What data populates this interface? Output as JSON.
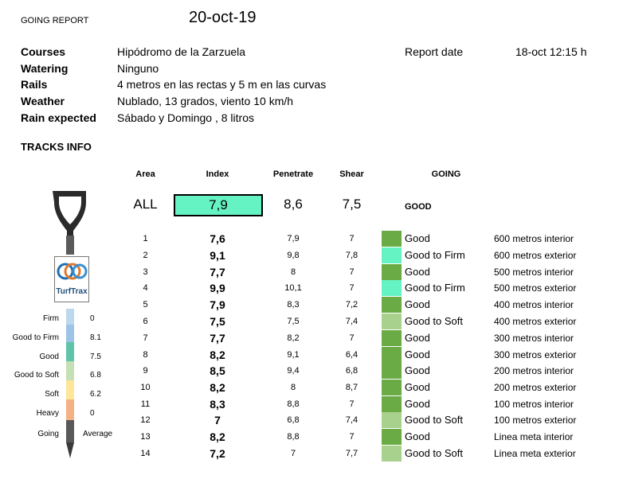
{
  "title": "GOING REPORT",
  "date": "20-oct-19",
  "info": {
    "courses": {
      "label": "Courses",
      "value": "Hipódromo de la Zarzuela"
    },
    "watering": {
      "label": "Watering",
      "value": "Ninguno"
    },
    "rails": {
      "label": "Rails",
      "value": "4 metros en las rectas y 5 m en las curvas"
    },
    "weather": {
      "label": "Weather",
      "value": "Nublado, 13 grados, viento 10 km/h"
    },
    "rain": {
      "label": "Rain expected",
      "value": "Sábado y Domingo , 8 litros"
    }
  },
  "report_date": {
    "label": "Report date",
    "value": "18-oct  12:15 h"
  },
  "tracks_info_label": "TRACKS INFO",
  "headers": {
    "area": "Area",
    "index": "Index",
    "penetrate": "Penetrate",
    "shear": "Shear",
    "going": "GOING"
  },
  "all_row": {
    "area": "ALL",
    "index": "7,9",
    "penetrate": "8,6",
    "shear": "7,5",
    "going": "GOOD"
  },
  "colors": {
    "good": "#6aab45",
    "good_to_firm": "#66f3c3",
    "good_to_soft": "#a9d18e"
  },
  "rows": [
    {
      "area": "1",
      "index": "7,6",
      "penetrate": "7,9",
      "shear": "7",
      "going": "Good",
      "location": "600 metros interior"
    },
    {
      "area": "2",
      "index": "9,1",
      "penetrate": "9,8",
      "shear": "7,8",
      "going": "Good to Firm",
      "location": "600 metros exterior"
    },
    {
      "area": "3",
      "index": "7,7",
      "penetrate": "8",
      "shear": "7",
      "going": "Good",
      "location": "500 metros interior"
    },
    {
      "area": "4",
      "index": "9,9",
      "penetrate": "10,1",
      "shear": "7",
      "going": "Good to Firm",
      "location": "500 metros exterior"
    },
    {
      "area": "5",
      "index": "7,9",
      "penetrate": "8,3",
      "shear": "7,2",
      "going": "Good",
      "location": "400 metros interior"
    },
    {
      "area": "6",
      "index": "7,5",
      "penetrate": "7,5",
      "shear": "7,4",
      "going": "Good to Soft",
      "location": "400 metros exterior"
    },
    {
      "area": "7",
      "index": "7,7",
      "penetrate": "8,2",
      "shear": "7",
      "going": "Good",
      "location": "300 metros interior"
    },
    {
      "area": "8",
      "index": "8,2",
      "penetrate": "9,1",
      "shear": "6,4",
      "going": "Good",
      "location": "300 metros exterior"
    },
    {
      "area": "9",
      "index": "8,5",
      "penetrate": "9,4",
      "shear": "6,8",
      "going": "Good",
      "location": "200 metros interior"
    },
    {
      "area": "10",
      "index": "8,2",
      "penetrate": "8",
      "shear": "8,7",
      "going": "Good",
      "location": "200 metros exterior"
    },
    {
      "area": "11",
      "index": "8,3",
      "penetrate": "8,8",
      "shear": "7",
      "going": "Good",
      "location": "100 metros interior"
    },
    {
      "area": "12",
      "index": "7",
      "penetrate": "6,8",
      "shear": "7,4",
      "going": "Good to Soft",
      "location": "100 metros exterior"
    },
    {
      "area": "13",
      "index": "8,2",
      "penetrate": "8,8",
      "shear": "7",
      "going": "Good",
      "location": "Linea meta interior"
    },
    {
      "area": "14",
      "index": "7,2",
      "penetrate": "7",
      "shear": "7,7",
      "going": "Good to Soft",
      "location": "Linea meta exterior"
    }
  ],
  "legend": [
    {
      "label": "Firm",
      "value": "0"
    },
    {
      "label": "Good to Firm",
      "value": "8.1"
    },
    {
      "label": "Good",
      "value": "7.5"
    },
    {
      "label": "Good to Soft",
      "value": "6.8"
    },
    {
      "label": "Soft",
      "value": "6.2"
    },
    {
      "label": "Heavy",
      "value": "0"
    },
    {
      "label": "Going",
      "value": "Average"
    }
  ],
  "logo_text": "TurfTrax"
}
